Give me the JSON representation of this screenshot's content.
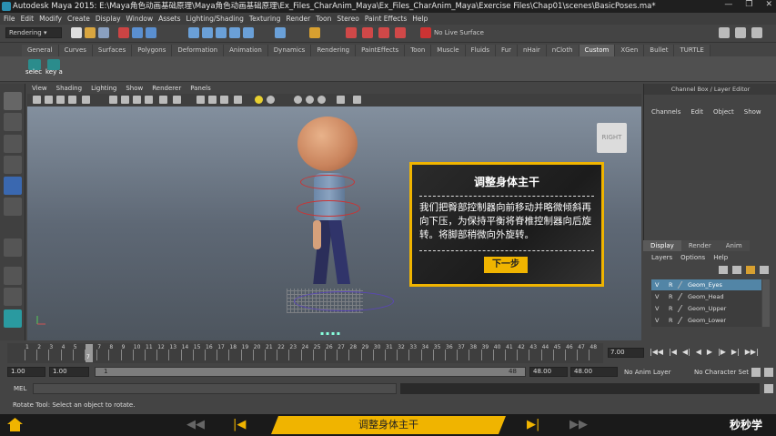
{
  "window": {
    "title": "Autodesk Maya 2015: E:\\Maya角色动画基础原理\\Maya角色动画基础原理\\Ex_Files_CharAnim_Maya\\Ex_Files_CharAnim_Maya\\Exercise Files\\Chap01\\scenes\\BasicPoses.ma*"
  },
  "menubar": [
    "File",
    "Edit",
    "Modify",
    "Create",
    "Display",
    "Window",
    "Assets",
    "Lighting/Shading",
    "Texturing",
    "Render",
    "Toon",
    "Stereo",
    "Paint Effects",
    "Help"
  ],
  "statusline": {
    "mode": "Rendering",
    "live_surface": "No Live Surface"
  },
  "shelf": {
    "tabs": [
      "General",
      "Curves",
      "Surfaces",
      "Polygons",
      "Deformation",
      "Animation",
      "Dynamics",
      "Rendering",
      "PaintEffects",
      "Toon",
      "Muscle",
      "Fluids",
      "Fur",
      "nHair",
      "nCloth",
      "Custom",
      "XGen",
      "Bullet",
      "TURTLE"
    ],
    "active_tab": "Custom",
    "buttons": [
      "selec",
      "key a"
    ]
  },
  "viewport": {
    "menu": [
      "View",
      "Shading",
      "Lighting",
      "Show",
      "Renderer",
      "Panels"
    ],
    "viewcube_label": "RIGHT"
  },
  "dialog": {
    "title": "调整身体主干",
    "body": "我们把臀部控制器向前移动并略微倾斜再向下压，为保持平衡将脊椎控制器向后旋转。将脚部稍微向外旋转。",
    "button": "下一步"
  },
  "channelbox": {
    "title": "Channel Box / Layer Editor",
    "menu": [
      "Channels",
      "Edit",
      "Object",
      "Show"
    ]
  },
  "layer_editor": {
    "tabs": [
      "Display",
      "Render",
      "Anim"
    ],
    "active_tab": "Display",
    "menu": [
      "Layers",
      "Options",
      "Help"
    ],
    "layers": [
      {
        "v": "V",
        "r": "R",
        "name": "Geom_Eyes",
        "selected": true
      },
      {
        "v": "V",
        "r": "R",
        "name": "Geom_Head",
        "selected": false
      },
      {
        "v": "V",
        "r": "R",
        "name": "Geom_Upper",
        "selected": false
      },
      {
        "v": "V",
        "r": "R",
        "name": "Geom_Lower",
        "selected": false
      }
    ]
  },
  "timeline": {
    "ticks": [
      "1",
      "2",
      "3",
      "4",
      "5",
      "6",
      "7",
      "8",
      "9",
      "10",
      "11",
      "12",
      "13",
      "14",
      "15",
      "16",
      "17",
      "18",
      "19",
      "20",
      "21",
      "22",
      "23",
      "24",
      "25",
      "26",
      "27",
      "28",
      "29",
      "30",
      "31",
      "32",
      "33",
      "34",
      "35",
      "36",
      "37",
      "38",
      "39",
      "40",
      "41",
      "42",
      "43",
      "44",
      "45",
      "46",
      "47",
      "48"
    ],
    "current_frame": "7",
    "current_time_field": "7.00"
  },
  "range": {
    "start": "1.00",
    "playback_start": "1.00",
    "slider_start": "1",
    "slider_end": "48",
    "playback_end": "48.00",
    "end": "48.00",
    "anim_layer": "No Anim Layer",
    "character_set": "No Character Set"
  },
  "command": {
    "label": "MEL"
  },
  "help_line": "Rotate Tool: Select an object to rotate.",
  "player": {
    "chapter_title": "调整身体主干",
    "logo": "秒秒学"
  }
}
